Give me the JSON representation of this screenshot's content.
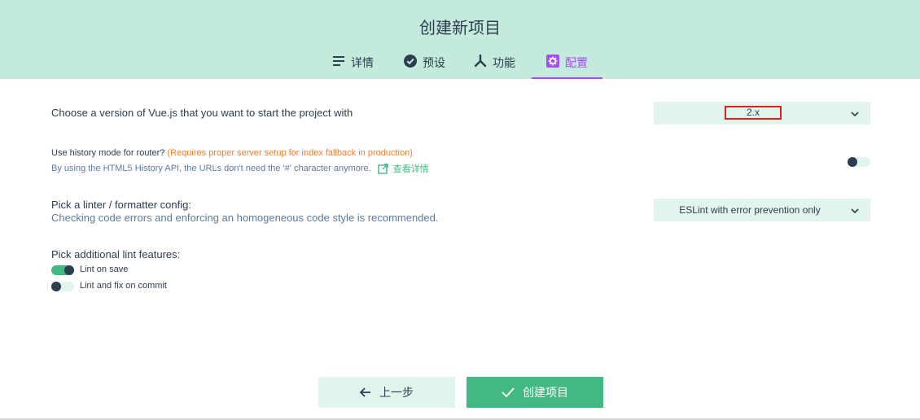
{
  "header": {
    "title": "创建新项目",
    "tabs": [
      {
        "label": "详情",
        "icon": "details-icon"
      },
      {
        "label": "预设",
        "icon": "check-circle-icon"
      },
      {
        "label": "功能",
        "icon": "fork-icon"
      },
      {
        "label": "配置",
        "icon": "gear-icon",
        "active": true
      }
    ]
  },
  "vue_version": {
    "label": "Choose a version of Vue.js that you want to start the project with",
    "value": "2.x"
  },
  "history_mode": {
    "label": "Use history mode for router?",
    "warning": "(Requires proper server setup for index fallback in production)",
    "description": "By using the HTML5 History API, the URLs don't need the '#' character anymore.",
    "link": "查看详情",
    "enabled": false
  },
  "linter": {
    "label": "Pick a linter / formatter config:",
    "description": "Checking code errors and enforcing an homogeneous code style is recommended.",
    "value": "ESLint with error prevention only"
  },
  "lint_features": {
    "label": "Pick additional lint features:",
    "options": [
      {
        "label": "Lint on save",
        "enabled": true
      },
      {
        "label": "Lint and fix on commit",
        "enabled": false
      }
    ]
  },
  "footer": {
    "prev_label": "上一步",
    "create_label": "创建项目"
  },
  "colors": {
    "header_bg": "#c4eadc",
    "accent": "#42b983",
    "active_tab": "#a44cf6",
    "warning": "#ff7b24",
    "highlight_box": "#e02020"
  }
}
